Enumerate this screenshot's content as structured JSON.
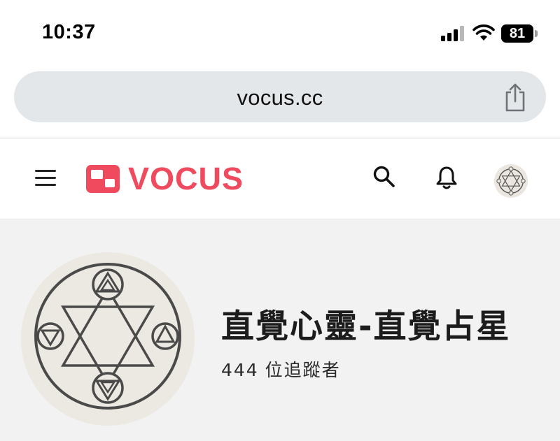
{
  "status_bar": {
    "time": "10:37",
    "battery_level": "81",
    "signal_bars_active": 3,
    "signal_bars_total": 4
  },
  "browser": {
    "url": "vocus.cc",
    "share_icon": "share-icon"
  },
  "site_header": {
    "menu_icon": "hamburger-menu-icon",
    "logo_text": "VOCUS",
    "search_icon": "search-icon",
    "notifications_icon": "bell-icon",
    "avatar_icon": "hexagram-avatar-icon",
    "brand_color": "#ef4a5e"
  },
  "profile": {
    "name": "直覺心靈-直覺占星",
    "follower_count": "444",
    "follower_label": "位追蹤者"
  }
}
